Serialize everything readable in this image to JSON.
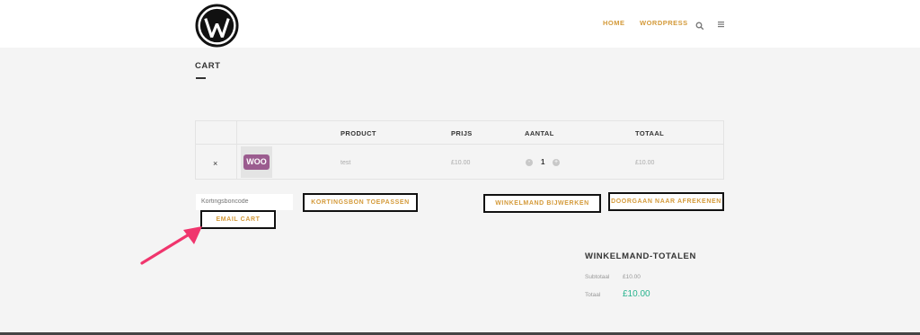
{
  "header": {
    "nav": [
      "HOME",
      "WORDPRESS"
    ],
    "icons": [
      "search-icon",
      "menu-icon"
    ]
  },
  "page": {
    "title": "CART"
  },
  "table": {
    "headers": [
      "PRODUCT",
      "PRIJS",
      "AANTAL",
      "TOTAAL"
    ],
    "rows": [
      {
        "remove": "×",
        "thumb_label": "WOO",
        "product": "test",
        "price": "£10.00",
        "qty": "1",
        "total": "£10.00"
      }
    ]
  },
  "actions": {
    "coupon_placeholder": "Kortingsboncode",
    "apply_coupon": "KORTINGSBON TOEPASSEN",
    "update_cart": "WINKELMAND BIJWERKEN",
    "checkout": "DOORGAAN NAAR AFREKENEN",
    "email_cart": "EMAIL CART"
  },
  "totals": {
    "title": "WINKELMAND-TOTALEN",
    "subtotal_label": "Subtotaal",
    "subtotal_value": "£10.00",
    "total_label": "Totaal",
    "total_value": "£10.00"
  },
  "colors": {
    "accent": "#d49a3a",
    "total": "#28b38e",
    "annotation_arrow": "#f0356d"
  }
}
